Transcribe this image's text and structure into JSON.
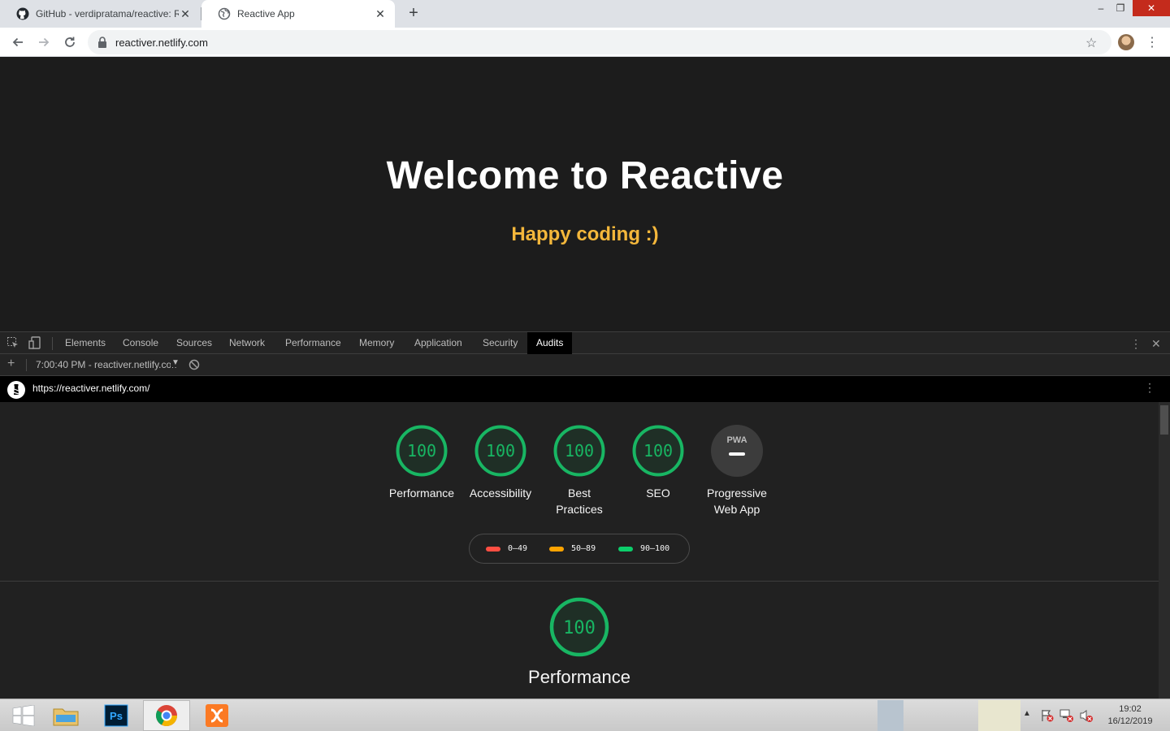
{
  "browser": {
    "tabs": [
      {
        "title": "GitHub - verdipratama/reactive: R",
        "active": false
      },
      {
        "title": "Reactive App",
        "active": true
      }
    ],
    "url": "reactiver.netlify.com"
  },
  "page": {
    "title": "Welcome to Reactive",
    "subtitle": "Happy coding :)",
    "subtitle_color": "#f4b73b"
  },
  "devtools": {
    "tabs": [
      "Elements",
      "Console",
      "Sources",
      "Network",
      "Performance",
      "Memory",
      "Application",
      "Security",
      "Audits"
    ],
    "active_tab": "Audits",
    "report_selector": "7:00:40 PM - reactiver.netlify.com"
  },
  "lighthouse": {
    "url": "https://reactiver.netlify.com/",
    "gauges": [
      {
        "score": "100",
        "label_line1": "Performance",
        "label_line2": ""
      },
      {
        "score": "100",
        "label_line1": "Accessibility",
        "label_line2": ""
      },
      {
        "score": "100",
        "label_line1": "Best",
        "label_line2": "Practices"
      },
      {
        "score": "100",
        "label_line1": "SEO",
        "label_line2": ""
      }
    ],
    "pwa": {
      "badge": "PWA",
      "label_line1": "Progressive",
      "label_line2": "Web App"
    },
    "legend": [
      {
        "range": "0–49",
        "color": "#ff4e42"
      },
      {
        "range": "50–89",
        "color": "#ffa400"
      },
      {
        "range": "90–100",
        "color": "#0cce6b"
      }
    ],
    "section": {
      "score": "100",
      "title": "Performance"
    },
    "pass_color": "#18b663"
  },
  "taskbar": {
    "apps": [
      "start",
      "file-explorer",
      "photoshop",
      "chrome",
      "xampp"
    ],
    "active_app": "chrome",
    "time": "19:02",
    "date": "16/12/2019"
  }
}
